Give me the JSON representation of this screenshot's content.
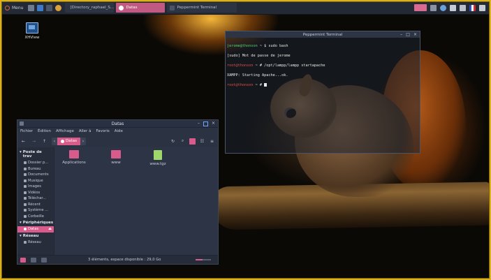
{
  "panel": {
    "menu_label": "Menu",
    "tasks": [
      {
        "label": "[Directory_raphael_S..."
      },
      {
        "label": "Datas"
      },
      {
        "label": "Peppermint Terminal"
      }
    ]
  },
  "desktop": {
    "icon_label": "XHView"
  },
  "terminal": {
    "title": "Peppermint Terminal",
    "lines": [
      {
        "user": "jerome@thonson",
        "rest": " ~ $ sudo bash"
      },
      {
        "text": "[sudo] Mot de passe de jerome"
      },
      {
        "user": "root@thonson",
        "rest": " ~ # /opt/lampp/lampp startapache"
      },
      {
        "text": "XAMPP: Starting Apache...ok."
      },
      {
        "user": "root@thonson",
        "rest": " ~ # "
      }
    ]
  },
  "filemanager": {
    "title": "Datas",
    "menu": [
      "Fichier",
      "Édition",
      "Affichage",
      "Aller à",
      "Favoris",
      "Aide"
    ],
    "breadcrumb": "Datas",
    "sidebar": {
      "places_header": "Poste de trav",
      "places": [
        "Dossier p...",
        "Bureau",
        "Documents",
        "Musique",
        "Images",
        "Vidéos",
        "Téléchar...",
        "Récent",
        "Système ...",
        "Corbeille"
      ],
      "devices_header": "Périphériques",
      "devices": [
        "Datas"
      ],
      "network_header": "Réseau",
      "network": [
        "Réseau"
      ]
    },
    "items": [
      {
        "label": "Applications",
        "type": "folder"
      },
      {
        "label": "www",
        "type": "folder"
      },
      {
        "label": "www.tgz",
        "type": "archive"
      }
    ],
    "status": "3 éléments, espace disponible : 29,0 Go"
  },
  "colors": {
    "accent": "#d95b8b",
    "frame": "#d9b21c"
  }
}
